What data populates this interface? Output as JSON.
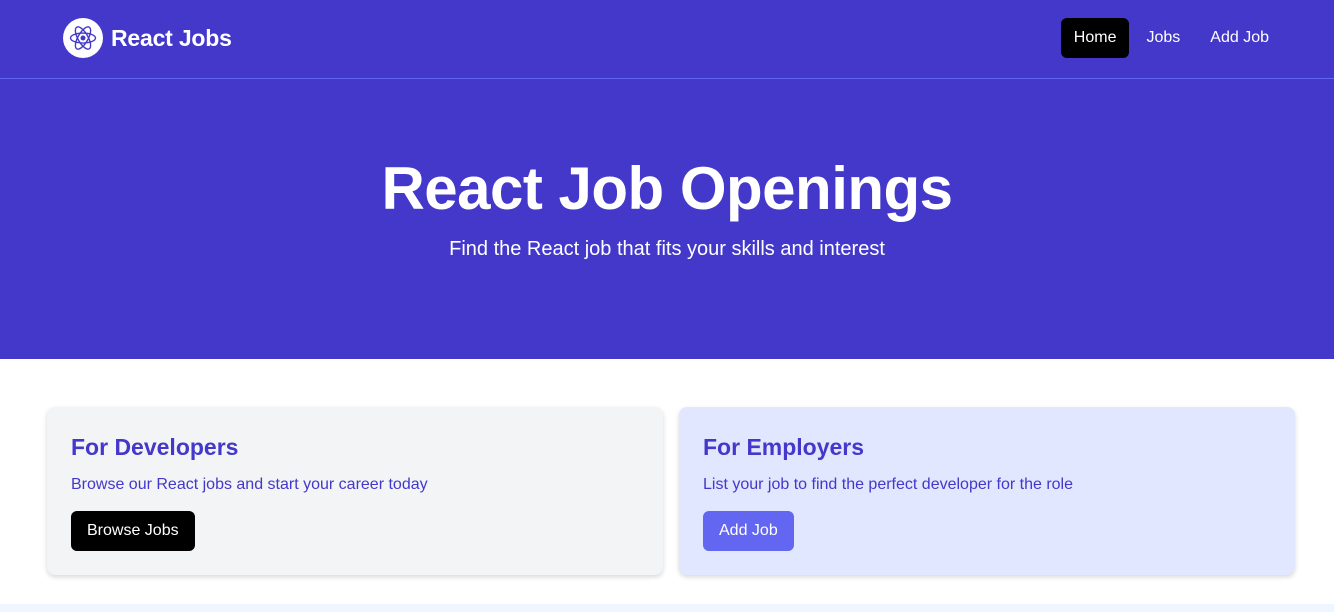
{
  "brand": {
    "title": "React Jobs",
    "logo_icon": "react-atom-icon"
  },
  "nav": {
    "items": [
      {
        "label": "Home",
        "active": true
      },
      {
        "label": "Jobs",
        "active": false
      },
      {
        "label": "Add Job",
        "active": false
      }
    ]
  },
  "hero": {
    "title": "React Job Openings",
    "subtitle": "Find the React job that fits your skills and interest"
  },
  "cards": [
    {
      "title": "For Developers",
      "text": "Browse our React jobs and start your career today",
      "button_label": "Browse Jobs"
    },
    {
      "title": "For Employers",
      "text": "List your job to find the perfect developer for the role",
      "button_label": "Add Job"
    }
  ],
  "colors": {
    "primary": "#4338ca",
    "accent": "#6366f1",
    "employer_card_bg": "#e0e7ff",
    "developer_card_bg": "#f3f4f6"
  }
}
